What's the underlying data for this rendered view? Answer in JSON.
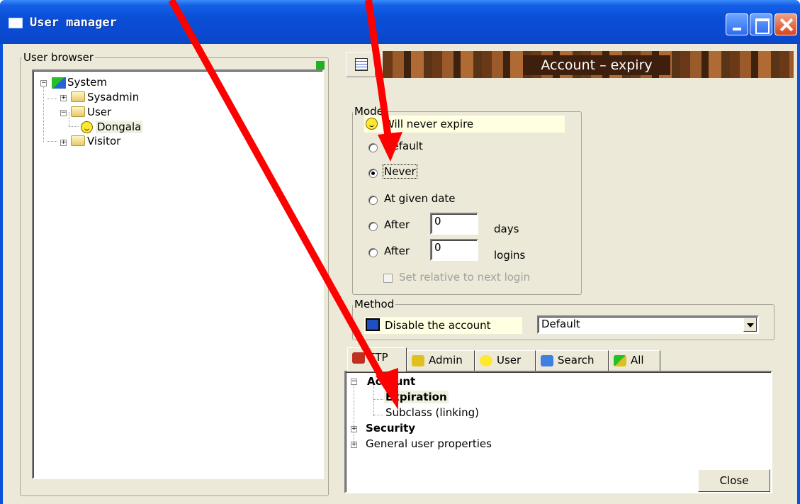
{
  "window": {
    "title": "User manager"
  },
  "user_browser": {
    "legend": "User browser",
    "tree": [
      {
        "label": "System"
      },
      {
        "label": "Sysadmin"
      },
      {
        "label": "User"
      },
      {
        "label": "Dongala"
      },
      {
        "label": "Visitor"
      }
    ]
  },
  "header": {
    "title": "Account – expiry"
  },
  "mode": {
    "legend": "Mode",
    "status": "Will never expire",
    "options": {
      "default": "Default",
      "never": "Never",
      "given_date": "At given date",
      "after_days": "After",
      "after_logins": "After"
    },
    "days_value": "0",
    "days_unit": "days",
    "logins_value": "0",
    "logins_unit": "logins",
    "relative_label": "Set relative to next login",
    "selected": "never"
  },
  "method": {
    "legend": "Method",
    "status": "Disable the account",
    "select_value": "Default"
  },
  "tabs": [
    "FTP",
    "Admin",
    "User",
    "Search",
    "All"
  ],
  "property_tree": {
    "account": "Account",
    "expiration": "Expiration",
    "subclass": "Subclass (linking)",
    "security": "Security",
    "general": "General user properties"
  },
  "close_label": "Close",
  "colors": {
    "titlebar": "#0a4fd6",
    "annotation_arrow": "#ff0000",
    "status_bg": "#ffffe1"
  },
  "icons": [
    "system-icon",
    "folder-icon",
    "smiley-icon",
    "monitor-icon",
    "magnifier-icon",
    "minimize-icon",
    "maximize-icon",
    "close-icon"
  ]
}
